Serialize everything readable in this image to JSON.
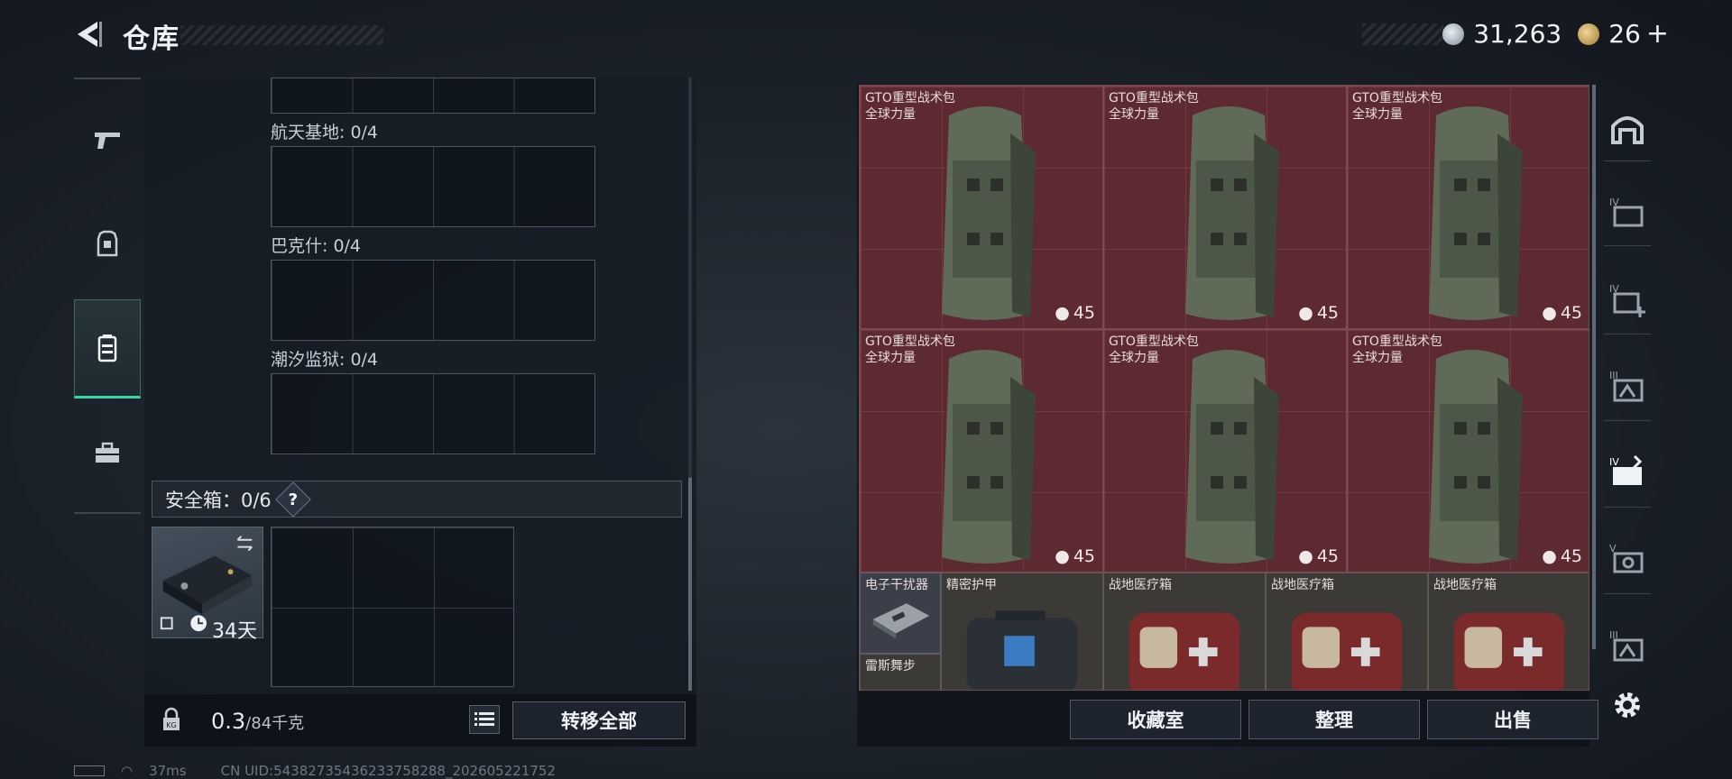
{
  "header": {
    "title": "仓库",
    "silver": "31,263",
    "gold": "26",
    "gold_plus": "+"
  },
  "left_panel": {
    "maps": [
      {
        "label": "航天基地: 0/4"
      },
      {
        "label": "巴克什: 0/4"
      },
      {
        "label": "潮汐监狱: 0/4"
      }
    ],
    "safe_box": {
      "label": "安全箱：0/6",
      "help": "?",
      "duration": "34天"
    },
    "weight": {
      "current": "0.3",
      "capacity": "/84千克"
    },
    "transfer_all": "转移全部"
  },
  "status": {
    "ping": "37ms",
    "uid": "CN UID:543827354362337582​88_202605221752"
  },
  "stash": {
    "bags": [
      {
        "name1": "GTO重型战术包",
        "name2": "全球力量",
        "count": "45"
      },
      {
        "name1": "GTO重型战术包",
        "name2": "全球力量",
        "count": "45"
      },
      {
        "name1": "GTO重型战术包",
        "name2": "全球力量",
        "count": "45"
      },
      {
        "name1": "GTO重型战术包",
        "name2": "全球力量",
        "count": "45"
      },
      {
        "name1": "GTO重型战术包",
        "name2": "全球力量",
        "count": "45"
      },
      {
        "name1": "GTO重型战术包",
        "name2": "全球力量",
        "count": "45"
      }
    ],
    "small_items": {
      "jammer": "电子干扰器",
      "armor": "精密护甲",
      "medkit1": "战地医疗箱",
      "medkit2": "战地医疗箱",
      "medkit3": "战地医疗箱",
      "leisi": "雷斯舞步"
    },
    "buttons": {
      "collection": "收藏室",
      "sort": "整理",
      "sell": "出售"
    }
  },
  "colors": {
    "accent": "#38d3a6",
    "stash_bg": "#5c2a30"
  }
}
